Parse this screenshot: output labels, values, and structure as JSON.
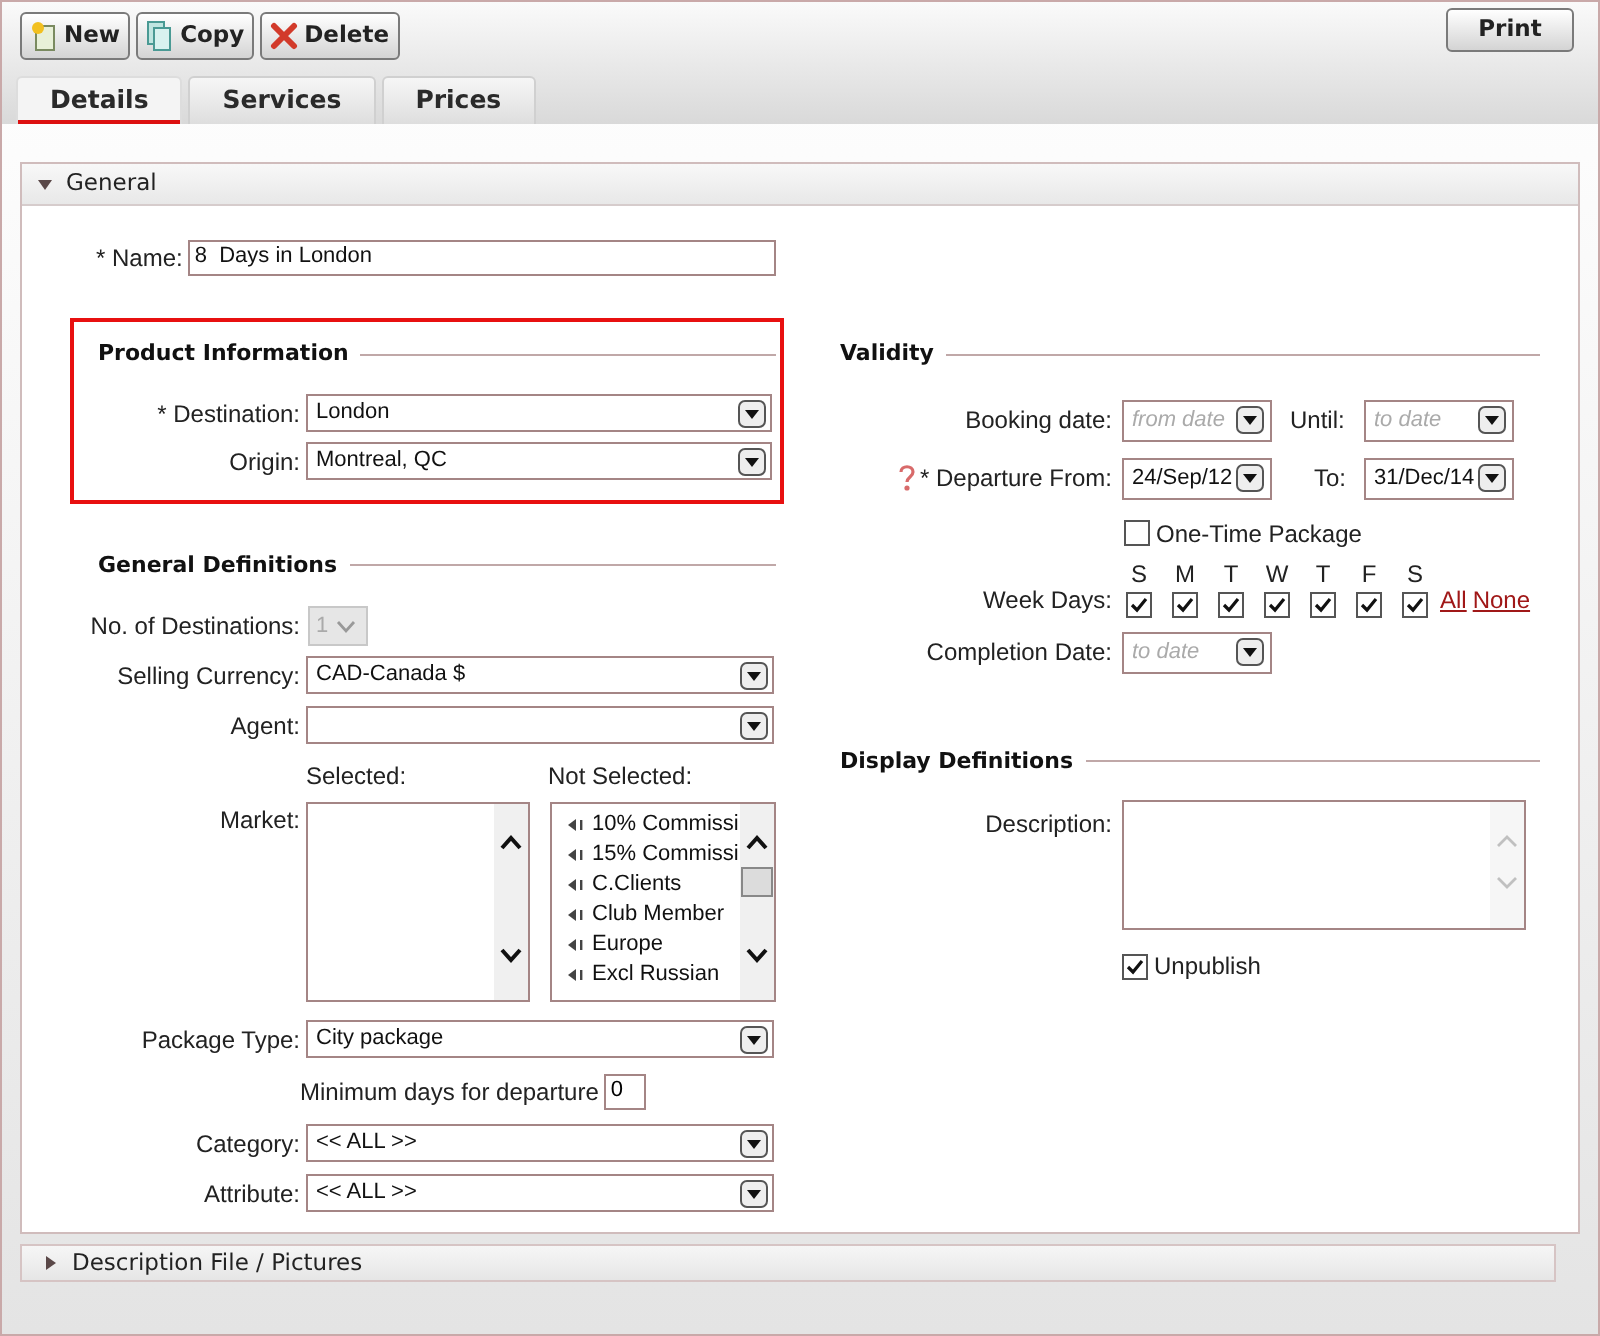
{
  "toolbar": {
    "buttons": [
      {
        "label": "New",
        "kind": "new"
      },
      {
        "label": "Copy",
        "kind": "copy"
      },
      {
        "label": "Delete",
        "kind": "delete"
      }
    ],
    "print": "Print"
  },
  "tabs": [
    {
      "label": "Details",
      "selected": true
    },
    {
      "label": "Services",
      "selected": false
    },
    {
      "label": "Prices",
      "selected": false
    }
  ],
  "general": {
    "title": "General",
    "expanded": true,
    "name": {
      "label": "* Name:",
      "value": "8  Days in London"
    },
    "product_information": {
      "title": "Product Information",
      "highlighted": true,
      "fields": [
        {
          "label": "* Destination:",
          "value": "London"
        },
        {
          "label": "Origin:",
          "value": "Montreal, QC"
        }
      ]
    },
    "general_definitions": {
      "title": "General Definitions",
      "fields": [
        {
          "kind": "small-select",
          "label": "No. of Destinations:",
          "value": "1",
          "disabled": true
        },
        {
          "kind": "select",
          "label": "Selling Currency:",
          "value": "CAD-Canada $"
        },
        {
          "kind": "select",
          "label": "Agent:"
        },
        {
          "kind": "market",
          "label": "Market:",
          "selected_label": "Selected:",
          "not_selected_label": "Not Selected:",
          "not_selected_items": [
            "10% Commissi",
            "15% Commissi",
            "C.Clients",
            "Club Member",
            "Europe",
            "Excl Russian"
          ]
        },
        {
          "kind": "select",
          "label": "Package Type:",
          "value": "City package"
        },
        {
          "kind": "number",
          "label": "Minimum days for departure",
          "value": "0"
        },
        {
          "kind": "select",
          "label": "Category:",
          "value": "<< ALL >>"
        },
        {
          "kind": "select",
          "label": "Attribute:",
          "value": "<< ALL >>"
        }
      ]
    },
    "validity": {
      "title": "Validity",
      "booking": {
        "label": "Booking date:",
        "from": {
          "placeholder": "from date"
        },
        "until_label": "Until:",
        "until": {
          "placeholder": "to date"
        }
      },
      "departure": {
        "label": "* Departure From:",
        "from": {
          "value": "24/Sep/12"
        },
        "to_label": "To:",
        "to": {
          "value": "31/Dec/14"
        }
      },
      "one_time": {
        "label": "One-Time Package",
        "checked": false
      },
      "week_days": {
        "label": "Week Days:",
        "days": [
          {
            "letter": "S",
            "checked": true
          },
          {
            "letter": "M",
            "checked": true
          },
          {
            "letter": "T",
            "checked": true
          },
          {
            "letter": "W",
            "checked": true
          },
          {
            "letter": "T",
            "checked": true
          },
          {
            "letter": "F",
            "checked": true
          },
          {
            "letter": "S",
            "checked": true
          }
        ],
        "all": "All",
        "none": "None"
      },
      "completion": {
        "label": "Completion Date:",
        "field": {
          "placeholder": "to date"
        }
      }
    },
    "display_definitions": {
      "title": "Display Definitions",
      "description_label": "Description:",
      "unpublish": {
        "label": "Unpublish",
        "checked": true
      }
    }
  },
  "collapsed_sections": [
    {
      "title": "Description File / Pictures",
      "expanded": false
    }
  ]
}
